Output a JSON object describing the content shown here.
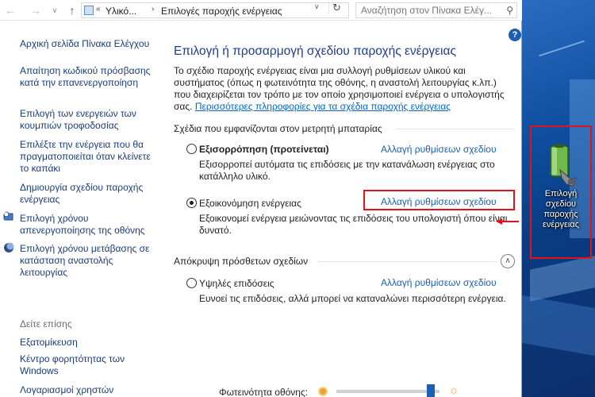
{
  "address": {
    "crumb_root": "Υλικό...",
    "crumb_current": "Επιλογές παροχής ενέργειας",
    "search_placeholder": "Αναζήτηση στον Πίνακα Ελέγ..."
  },
  "sidebar": {
    "items": [
      {
        "label": "Αρχική σελίδα Πίνακα Ελέγχου"
      },
      {
        "label": "Απαίτηση κωδικού πρόσβασης κατά την επανενεργοποίηση"
      },
      {
        "label": "Επιλογή των ενεργειών των κουμπιών τροφοδοσίας"
      },
      {
        "label": "Επιλέξτε την ενέργεια που θα πραγματοποιείται όταν κλείνετε το καπάκι"
      },
      {
        "label": "Δημιουργία σχεδίου παροχής ενέργειας"
      },
      {
        "label": "Επιλογή χρόνου απενεργοποίησης της οθόνης"
      },
      {
        "label": "Επιλογή χρόνου μετάβασης σε κατάσταση αναστολής λειτουργίας"
      }
    ],
    "see_also": "Δείτε επίσης",
    "see_also_items": [
      {
        "label": "Εξατομίκευση"
      },
      {
        "label": "Κέντρο φορητότητας των Windows"
      },
      {
        "label": "Λογαριασμοί χρηστών"
      }
    ]
  },
  "main": {
    "title": "Επιλογή ή προσαρμογή σχεδίου παροχής ενέργειας",
    "intro": "Το σχέδιο παροχής ενέργειας είναι μια συλλογή ρυθμίσεων υλικού και συστήματος (όπως η φωτεινότητα της οθόνης, η αναστολή λειτουργίας κ.λπ.) που διαχειρίζεται τον τρόπο με τον οποίο χρησιμοποιεί ενέργεια ο υπολογιστής σας.",
    "intro_link": "Περισσότερες πληροφορίες για τα σχέδια παροχής ενέργειας",
    "section_battery": "Σχέδια που εμφανίζονται στον μετρητή μπαταρίας",
    "section_hidden": "Απόκρυψη πρόσθετων σχεδίων",
    "change_label": "Αλλαγή ρυθμίσεων σχεδίου",
    "plans": [
      {
        "name": "Εξισορρόπηση (προτείνεται)",
        "desc": "Εξισορροπεί αυτόματα τις επιδόσεις με την κατανάλωση ενέργειας στο κατάλληλο υλικό.",
        "selected": false
      },
      {
        "name": "Εξοικονόμηση ενέργειας",
        "desc": "Εξοικονομεί ενέργεια μειώνοντας τις επιδόσεις του υπολογιστή όπου είναι δυνατό.",
        "selected": true
      },
      {
        "name": "Υψηλές επιδόσεις",
        "desc": "Ευνοεί τις επιδόσεις, αλλά μπορεί να καταναλώνει περισσότερη ενέργεια.",
        "selected": false
      }
    ],
    "brightness_label": "Φωτεινότητα οθόνης:",
    "brightness_level": 0.95
  },
  "desktop_icon": {
    "label": "Επιλογή σχεδίου παροχής ενέργειας"
  },
  "colors": {
    "highlight": "#e0121b",
    "link": "#1a5fb4",
    "title": "#1e3d8f"
  }
}
